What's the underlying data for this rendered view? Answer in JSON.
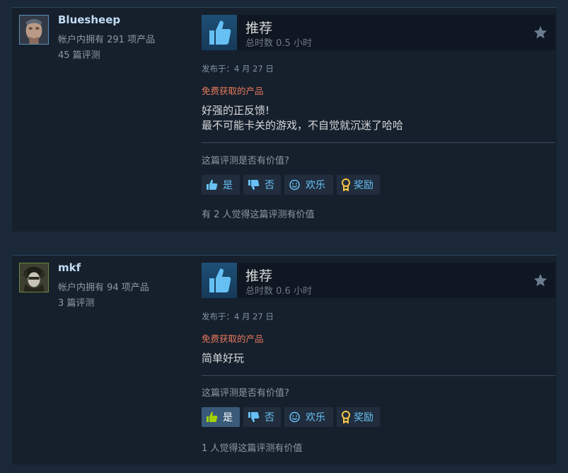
{
  "reviews": [
    {
      "author": {
        "name": "Bluesheep",
        "products_owned": "帐户内拥有 291 项产品",
        "reviews_count": "45 篇评测",
        "avatar_icon": "avatar-portrait-icon"
      },
      "vote_title": "推荐",
      "hours": "总时数 0.5 小时",
      "posted": "发布于：4 月 27 日",
      "free_product": "免费获取的产品",
      "body_lines": [
        "好强的正反馈!",
        "最不可能卡关的游戏，不自觉就沉迷了哈哈"
      ],
      "helpful_question": "这篇评测是否有价值?",
      "buttons": {
        "yes": "是",
        "no": "否",
        "funny": "欢乐",
        "award": "奖励"
      },
      "yes_selected": false,
      "helpful_count": "有 2 人觉得这篇评测有价值"
    },
    {
      "author": {
        "name": "mkf",
        "products_owned": "帐户内拥有 94 项产品",
        "reviews_count": "3 篇评测",
        "avatar_icon": "avatar-dark-knight-icon"
      },
      "vote_title": "推荐",
      "hours": "总时数 0.6 小时",
      "posted": "发布于：4 月 27 日",
      "free_product": "免费获取的产品",
      "body_lines": [
        "简单好玩"
      ],
      "helpful_question": "这篇评测是否有价值?",
      "buttons": {
        "yes": "是",
        "no": "否",
        "funny": "欢乐",
        "award": "奖励"
      },
      "yes_selected": true,
      "helpful_count": "1 人觉得这篇评测有价值"
    }
  ],
  "colors": {
    "page_bg": "#1b2838",
    "card_bg": "#16202d",
    "free_product": "#e8795a",
    "link_blue": "#67c1f5",
    "thumb_blue": "#66c0f4"
  }
}
